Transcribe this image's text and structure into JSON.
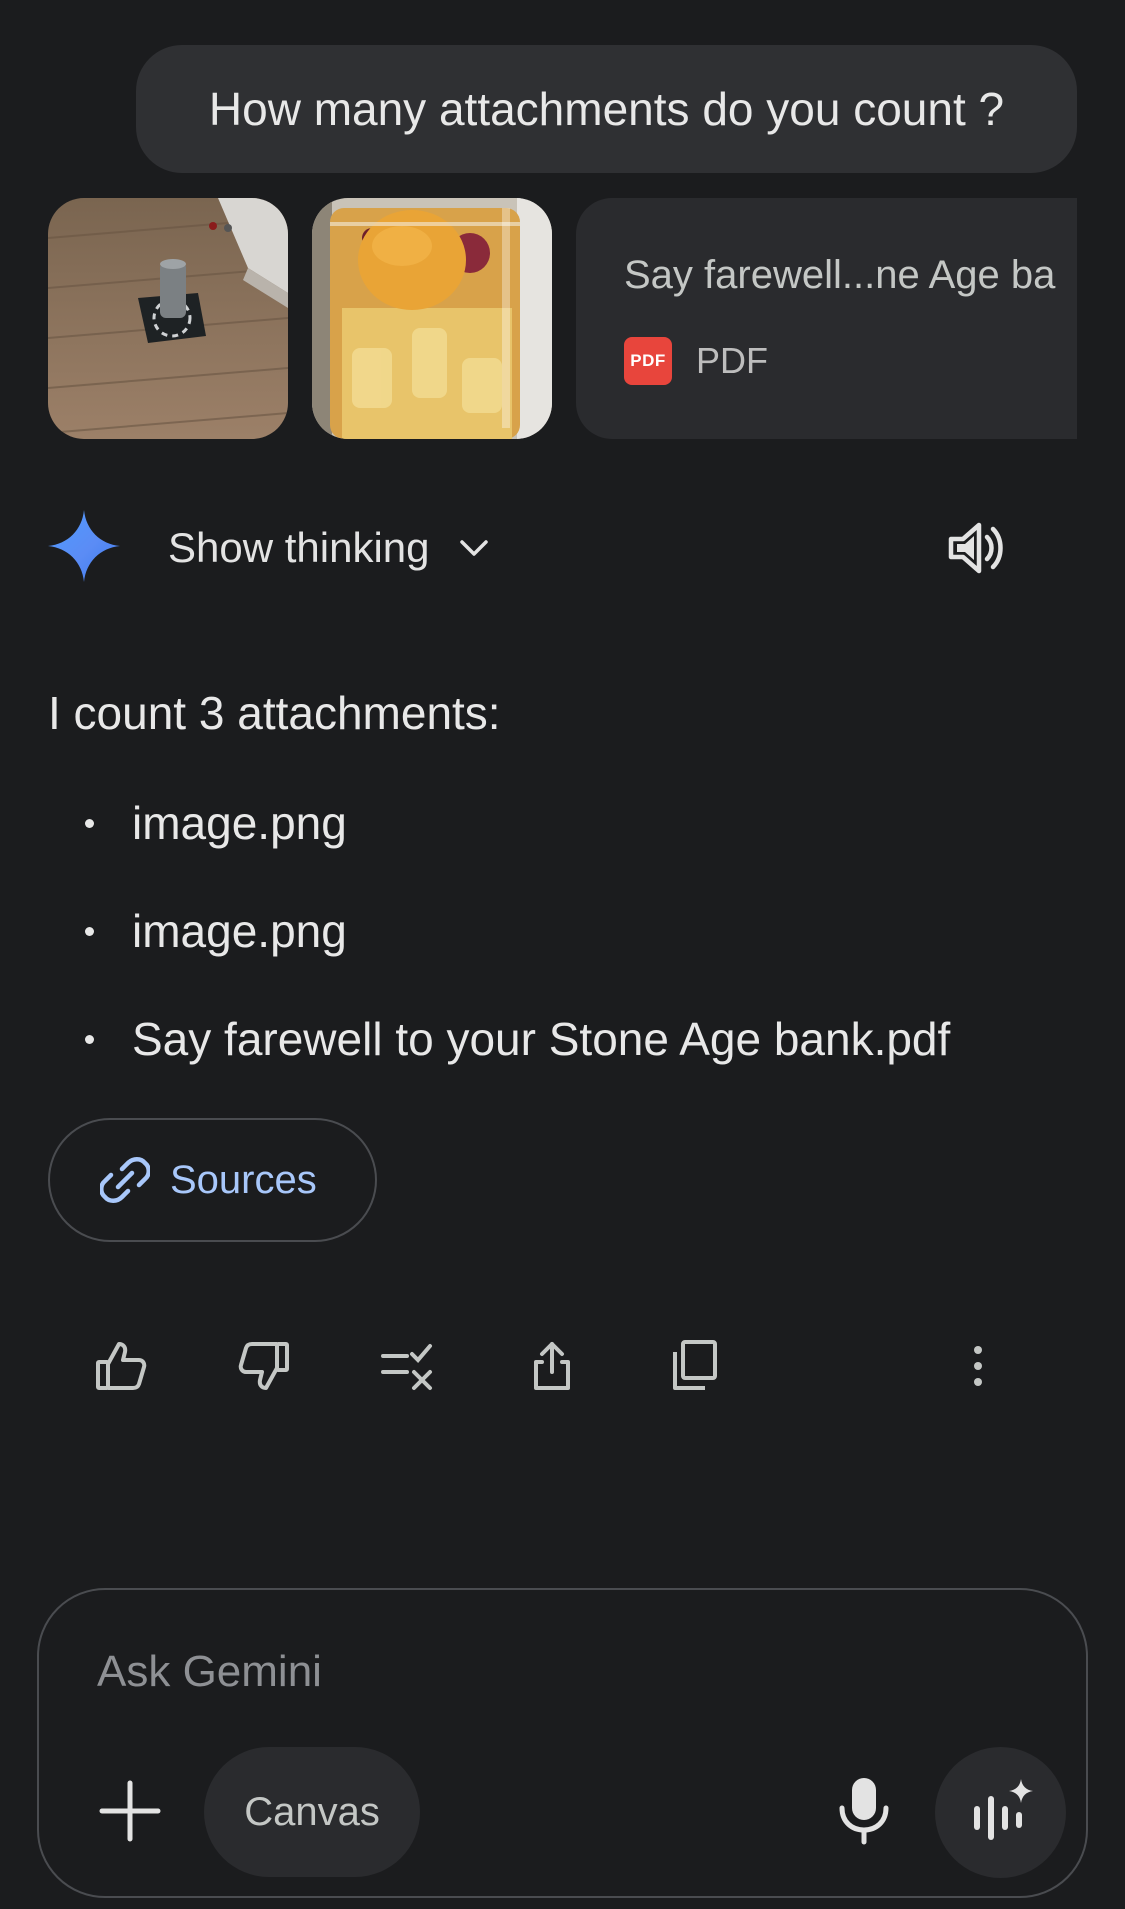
{
  "user_message": {
    "text": "How many attachments do you count ?"
  },
  "attachments": {
    "images": [
      {
        "icon": "photo-thumbnail"
      },
      {
        "icon": "photo-thumbnail"
      }
    ],
    "pdf": {
      "title": "Say farewell...ne Age ba",
      "type_label": "PDF",
      "badge_text": "PDF",
      "badge_color": "#e8453c"
    }
  },
  "response_header": {
    "show_thinking_label": "Show thinking",
    "icons": {
      "model": "gemini-sparkle-icon",
      "expand": "chevron-down-icon",
      "listen": "speaker-icon"
    }
  },
  "response": {
    "intro": "I count 3 attachments:",
    "items": [
      "image.png",
      "image.png",
      "Say farewell to your Stone Age bank.pdf"
    ],
    "sources_label": "Sources",
    "sources_color": "#a8c7fa"
  },
  "actions": {
    "icons": [
      "thumbs-up-icon",
      "thumbs-down-icon",
      "double-check-icon",
      "share-icon",
      "copy-icon",
      "more-vert-icon"
    ]
  },
  "composer": {
    "placeholder": "Ask Gemini",
    "canvas_label": "Canvas",
    "icons": {
      "add": "plus-icon",
      "voice": "microphone-icon",
      "live": "gemini-live-icon"
    }
  },
  "colors": {
    "background": "#1b1c1e",
    "bubble": "#2f3033",
    "card": "#2a2b2e",
    "accent_blue": "#a8c7fa"
  }
}
